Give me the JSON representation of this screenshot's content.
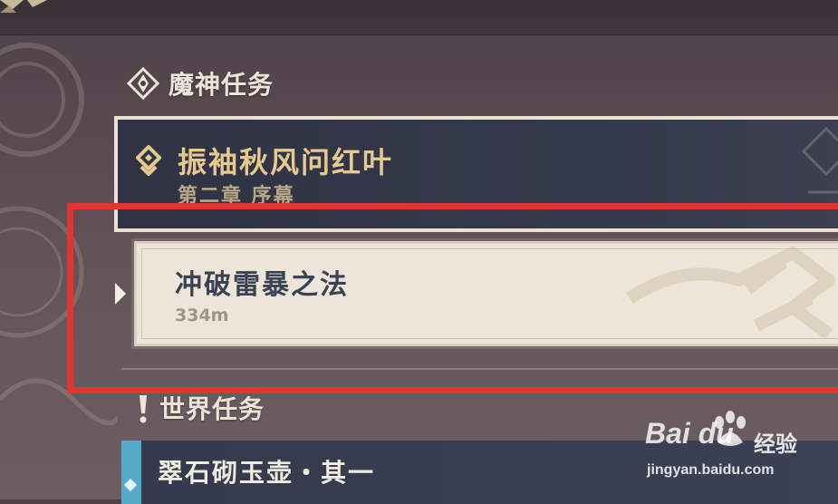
{
  "sections": {
    "archon": {
      "header_label": "魔神任务",
      "quest_title": "振袖秋风问红叶",
      "quest_chapter": "第二章 序幕"
    },
    "active_objective": {
      "title": "冲破雷暴之法",
      "distance": "334m"
    },
    "world": {
      "header_label": "世界任务",
      "quest_title": "翠石砌玉壶・其一"
    }
  },
  "watermark": {
    "brand": "Bai du",
    "jingyan": "经验",
    "url": "jingyan.baidu.com"
  },
  "colors": {
    "highlight_box": "#e43330",
    "archon_gold": "#e6c98e",
    "world_blue": "#56a9c7",
    "active_card_bg": "#ece5d8"
  },
  "icons": {
    "archon": "archon-quest-icon",
    "world": "world-quest-exclamation-icon",
    "selected": "selection-arrow-icon"
  }
}
